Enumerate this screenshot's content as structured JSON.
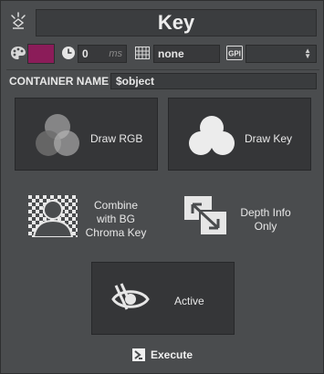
{
  "header": {
    "title": "Key"
  },
  "toolbar": {
    "color": "#8b1c59",
    "duration_value": "0",
    "duration_unit": "ms",
    "grid_value": "none",
    "gpi_label": "GPI",
    "gpi_select_value": ""
  },
  "container": {
    "label": "CONTAINER NAME",
    "value": "$object"
  },
  "buttons": {
    "draw_rgb": "Draw RGB",
    "draw_key": "Draw Key",
    "combine": [
      "Combine",
      "with BG",
      "Chroma Key"
    ],
    "depth": [
      "Depth Info",
      "Only"
    ],
    "active": "Active",
    "execute": "Execute"
  },
  "icons": {
    "top": "sparkle-icon",
    "palette": "palette-icon",
    "clock": "clock-icon",
    "grid": "grid-icon",
    "gpi": "gpi-icon",
    "draw_rgb": "rgb-circles-icon",
    "draw_key": "key-circles-icon",
    "combine": "chroma-person-icon",
    "depth": "depth-arrows-icon",
    "active": "eye-hidden-icon",
    "execute": "execute-icon"
  },
  "colors": {
    "background": "#4b4d4f",
    "button_bg": "#353638",
    "swatch": "#8b1c59"
  }
}
